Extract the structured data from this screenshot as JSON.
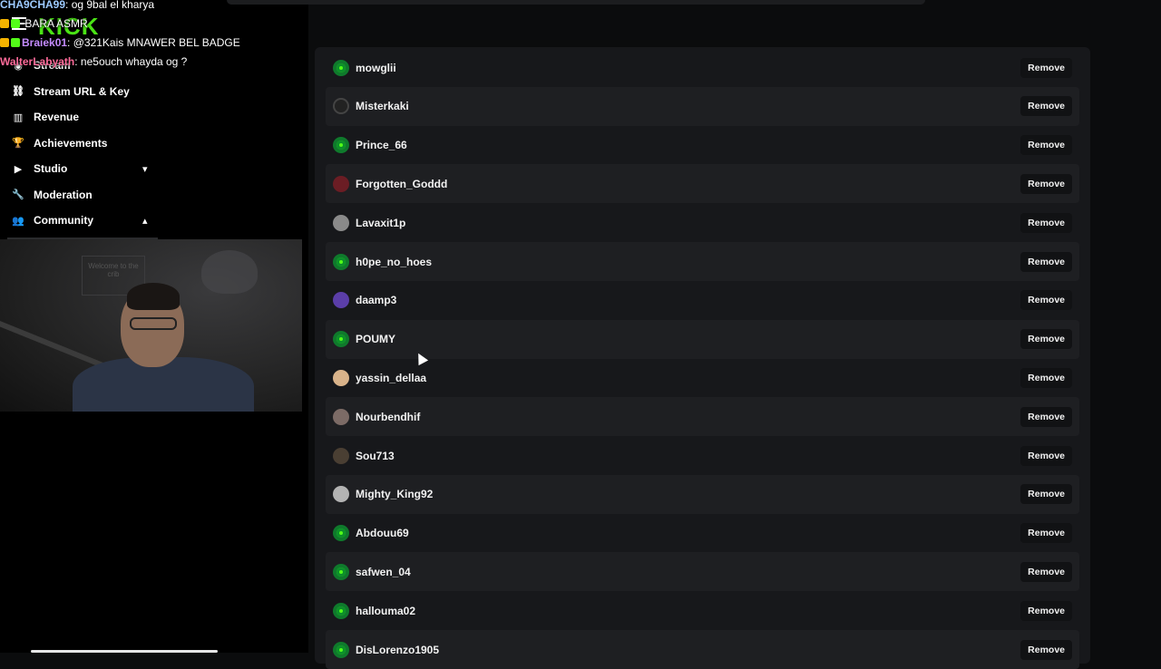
{
  "app": {
    "brand": "KICK"
  },
  "chat": [
    {
      "user": "CHA9CHA99",
      "user_color": "#9ecbff",
      "message": "og 9bal el kharya"
    },
    {
      "user": "",
      "user_color": "#53fc18",
      "message": "BARA ASMR"
    },
    {
      "user": "Braiek01",
      "user_color": "#c58cff",
      "message": "@321Kais MNAWER BEL BADGE"
    },
    {
      "user": "WalterLabyath",
      "user_color": "#ff6b9a",
      "message": "ne5ouch whayda og ?"
    }
  ],
  "nav": {
    "items": [
      {
        "label": "Stream",
        "icon": "broadcast-icon"
      },
      {
        "label": "Stream URL & Key",
        "icon": "link-icon"
      },
      {
        "label": "Revenue",
        "icon": "chart-icon"
      },
      {
        "label": "Achievements",
        "icon": "trophy-icon"
      },
      {
        "label": "Studio",
        "icon": "video-icon",
        "chevron": "chevron-down-icon"
      },
      {
        "label": "Moderation",
        "icon": "wrench-icon"
      },
      {
        "label": "Community",
        "icon": "users-icon",
        "chevron": "chevron-up-icon"
      }
    ]
  },
  "webcam": {
    "poster_text": "Welcome to the crib"
  },
  "users": [
    {
      "name": "mowglii",
      "avatar": "green"
    },
    {
      "name": "Misterkaki",
      "avatar": "dark"
    },
    {
      "name": "Prince_66",
      "avatar": "green"
    },
    {
      "name": "Forgotten_Goddd",
      "avatar": "red"
    },
    {
      "name": "Lavaxit1p",
      "avatar": "grey"
    },
    {
      "name": "h0pe_no_hoes",
      "avatar": "green"
    },
    {
      "name": "daamp3",
      "avatar": "purple"
    },
    {
      "name": "POUMY",
      "avatar": "green"
    },
    {
      "name": "yassin_dellaa",
      "avatar": "tan"
    },
    {
      "name": "Nourbendhif",
      "avatar": "mixed"
    },
    {
      "name": "Sou713",
      "avatar": "brown"
    },
    {
      "name": "Mighty_King92",
      "avatar": "silver"
    },
    {
      "name": "Abdouu69",
      "avatar": "green"
    },
    {
      "name": "safwen_04",
      "avatar": "green"
    },
    {
      "name": "hallouma02",
      "avatar": "green"
    },
    {
      "name": "DisLorenzo1905",
      "avatar": "green"
    }
  ],
  "remove_label": "Remove",
  "colors": {
    "accent": "#53fc18",
    "panel": "#17181b",
    "row_alt": "#1e1f22"
  }
}
